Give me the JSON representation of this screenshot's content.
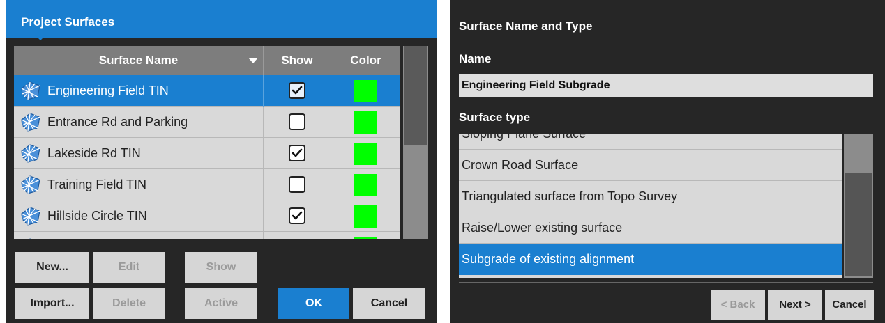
{
  "left": {
    "title": "Project Surfaces",
    "columns": {
      "name": "Surface Name",
      "show": "Show",
      "color": "Color"
    },
    "rows": [
      {
        "label": "Engineering Field TIN",
        "show": true,
        "color": "#00ff00",
        "selected": true
      },
      {
        "label": "Entrance Rd and Parking",
        "show": false,
        "color": "#00ff00",
        "selected": false
      },
      {
        "label": "Lakeside Rd TIN",
        "show": true,
        "color": "#00ff00",
        "selected": false
      },
      {
        "label": "Training Field TIN",
        "show": false,
        "color": "#00ff00",
        "selected": false
      },
      {
        "label": "Hillside Circle TIN",
        "show": true,
        "color": "#00ff00",
        "selected": false
      }
    ],
    "buttons": {
      "new": "New...",
      "edit": "Edit",
      "show": "Show",
      "import": "Import...",
      "delete": "Delete",
      "active": "Active",
      "ok": "OK",
      "cancel": "Cancel"
    }
  },
  "right": {
    "title": "Surface Name and Type",
    "name_label": "Name",
    "name_value": "Engineering Field Subgrade",
    "type_label": "Surface type",
    "types": [
      {
        "label": "Sloping Plane Surface",
        "selected": false
      },
      {
        "label": "Crown Road Surface",
        "selected": false
      },
      {
        "label": "Triangulated surface from Topo Survey",
        "selected": false
      },
      {
        "label": "Raise/Lower existing surface",
        "selected": false
      },
      {
        "label": "Subgrade of existing alignment",
        "selected": true
      }
    ],
    "buttons": {
      "back": "< Back",
      "next": "Next >",
      "cancel": "Cancel"
    }
  },
  "colors": {
    "accent": "#1a7fd0",
    "panel_bg": "#262626",
    "swatch_green": "#00ff00"
  }
}
